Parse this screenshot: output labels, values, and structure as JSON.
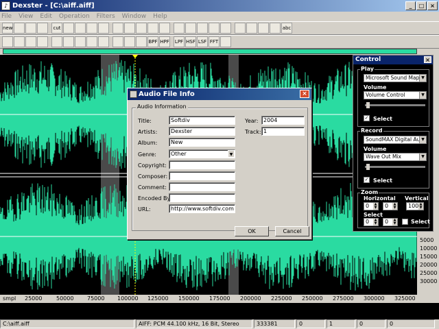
{
  "window": {
    "title": "Dexster - [C:\\aiff.aiff]"
  },
  "menu": [
    "File",
    "View",
    "Edit",
    "Operation",
    "Filters",
    "Window",
    "Help"
  ],
  "toolbar1": [
    "new",
    "open",
    "save",
    "close",
    "cut",
    "copy",
    "paste",
    "delete",
    "undo",
    "redo",
    "zoom-in",
    "zoom-out",
    "zoom-sel",
    "zoom-all",
    "play",
    "play-loop",
    "play-all",
    "record",
    "pause",
    "stop",
    "stop-all",
    "volume",
    "mixer",
    "abc"
  ],
  "toolbar2": [
    "select-all",
    "split",
    "wave",
    "envelope",
    "fade-in",
    "fade-out",
    "denoise",
    "effect",
    "loop",
    "reverb",
    "repeat",
    "band",
    "BPF",
    "HPF",
    "LPF",
    "HSF",
    "LSF",
    "FFT",
    "notes"
  ],
  "waveform": {
    "colors": {
      "wave": "#2adba1",
      "bg": "#000000",
      "selection": "#4a4a4a",
      "marker": "#ffff00"
    },
    "y_ticks": [
      "5000",
      "10000",
      "15000",
      "20000",
      "25000",
      "30000"
    ],
    "x_ticks": [
      "smpl",
      "25000",
      "50000",
      "75000",
      "100000",
      "125000",
      "150000",
      "175000",
      "200000",
      "225000",
      "250000",
      "275000",
      "300000",
      "325000"
    ]
  },
  "control_panel": {
    "title": "Control",
    "play": {
      "label": "Play",
      "device": "Microsoft Sound Mapper",
      "volume_label": "Volume",
      "volume_source": "Volume Control",
      "select_label": "Select"
    },
    "record": {
      "label": "Record",
      "device": "SoundMAX Digital Audio",
      "volume_label": "Volume",
      "volume_source": "Wave Out Mix",
      "select_label": "Select"
    },
    "zoom": {
      "label": "Zoom",
      "horizontal_label": "Horizontal",
      "vertical_label": "Vertical",
      "h1": "0",
      "h2": "0",
      "v": "100",
      "select_label": "Select",
      "s1": "0",
      "s2": "0",
      "select2_label": "Select"
    }
  },
  "dialog": {
    "title": "Audio File Info",
    "group_label": "Audio Information",
    "fields": {
      "title": {
        "label": "Title:",
        "value": "Softdiv"
      },
      "artists": {
        "label": "Artists:",
        "value": "Dexster"
      },
      "album": {
        "label": "Album:",
        "value": "New"
      },
      "genre": {
        "label": "Genre:",
        "value": "Other"
      },
      "copyright": {
        "label": "Copyright:",
        "value": ""
      },
      "composer": {
        "label": "Composer:",
        "value": ""
      },
      "comment": {
        "label": "Comment:",
        "value": ""
      },
      "encoded_by": {
        "label": "Encoded By:",
        "value": ""
      },
      "url": {
        "label": "URL:",
        "value": "http://www.softdiv.com"
      },
      "year": {
        "label": "Year:",
        "value": "2004"
      },
      "track": {
        "label": "Track:",
        "value": "1"
      }
    },
    "ok_label": "OK",
    "cancel_label": "Cancel"
  },
  "status": {
    "file": "C:\\aiff.aiff",
    "format": "AIFF: PCM 44.100 kHz, 16 Bit, Stereo",
    "samples": "333381",
    "v1": "0",
    "v2": "1",
    "v3": "0",
    "v4": "0"
  }
}
